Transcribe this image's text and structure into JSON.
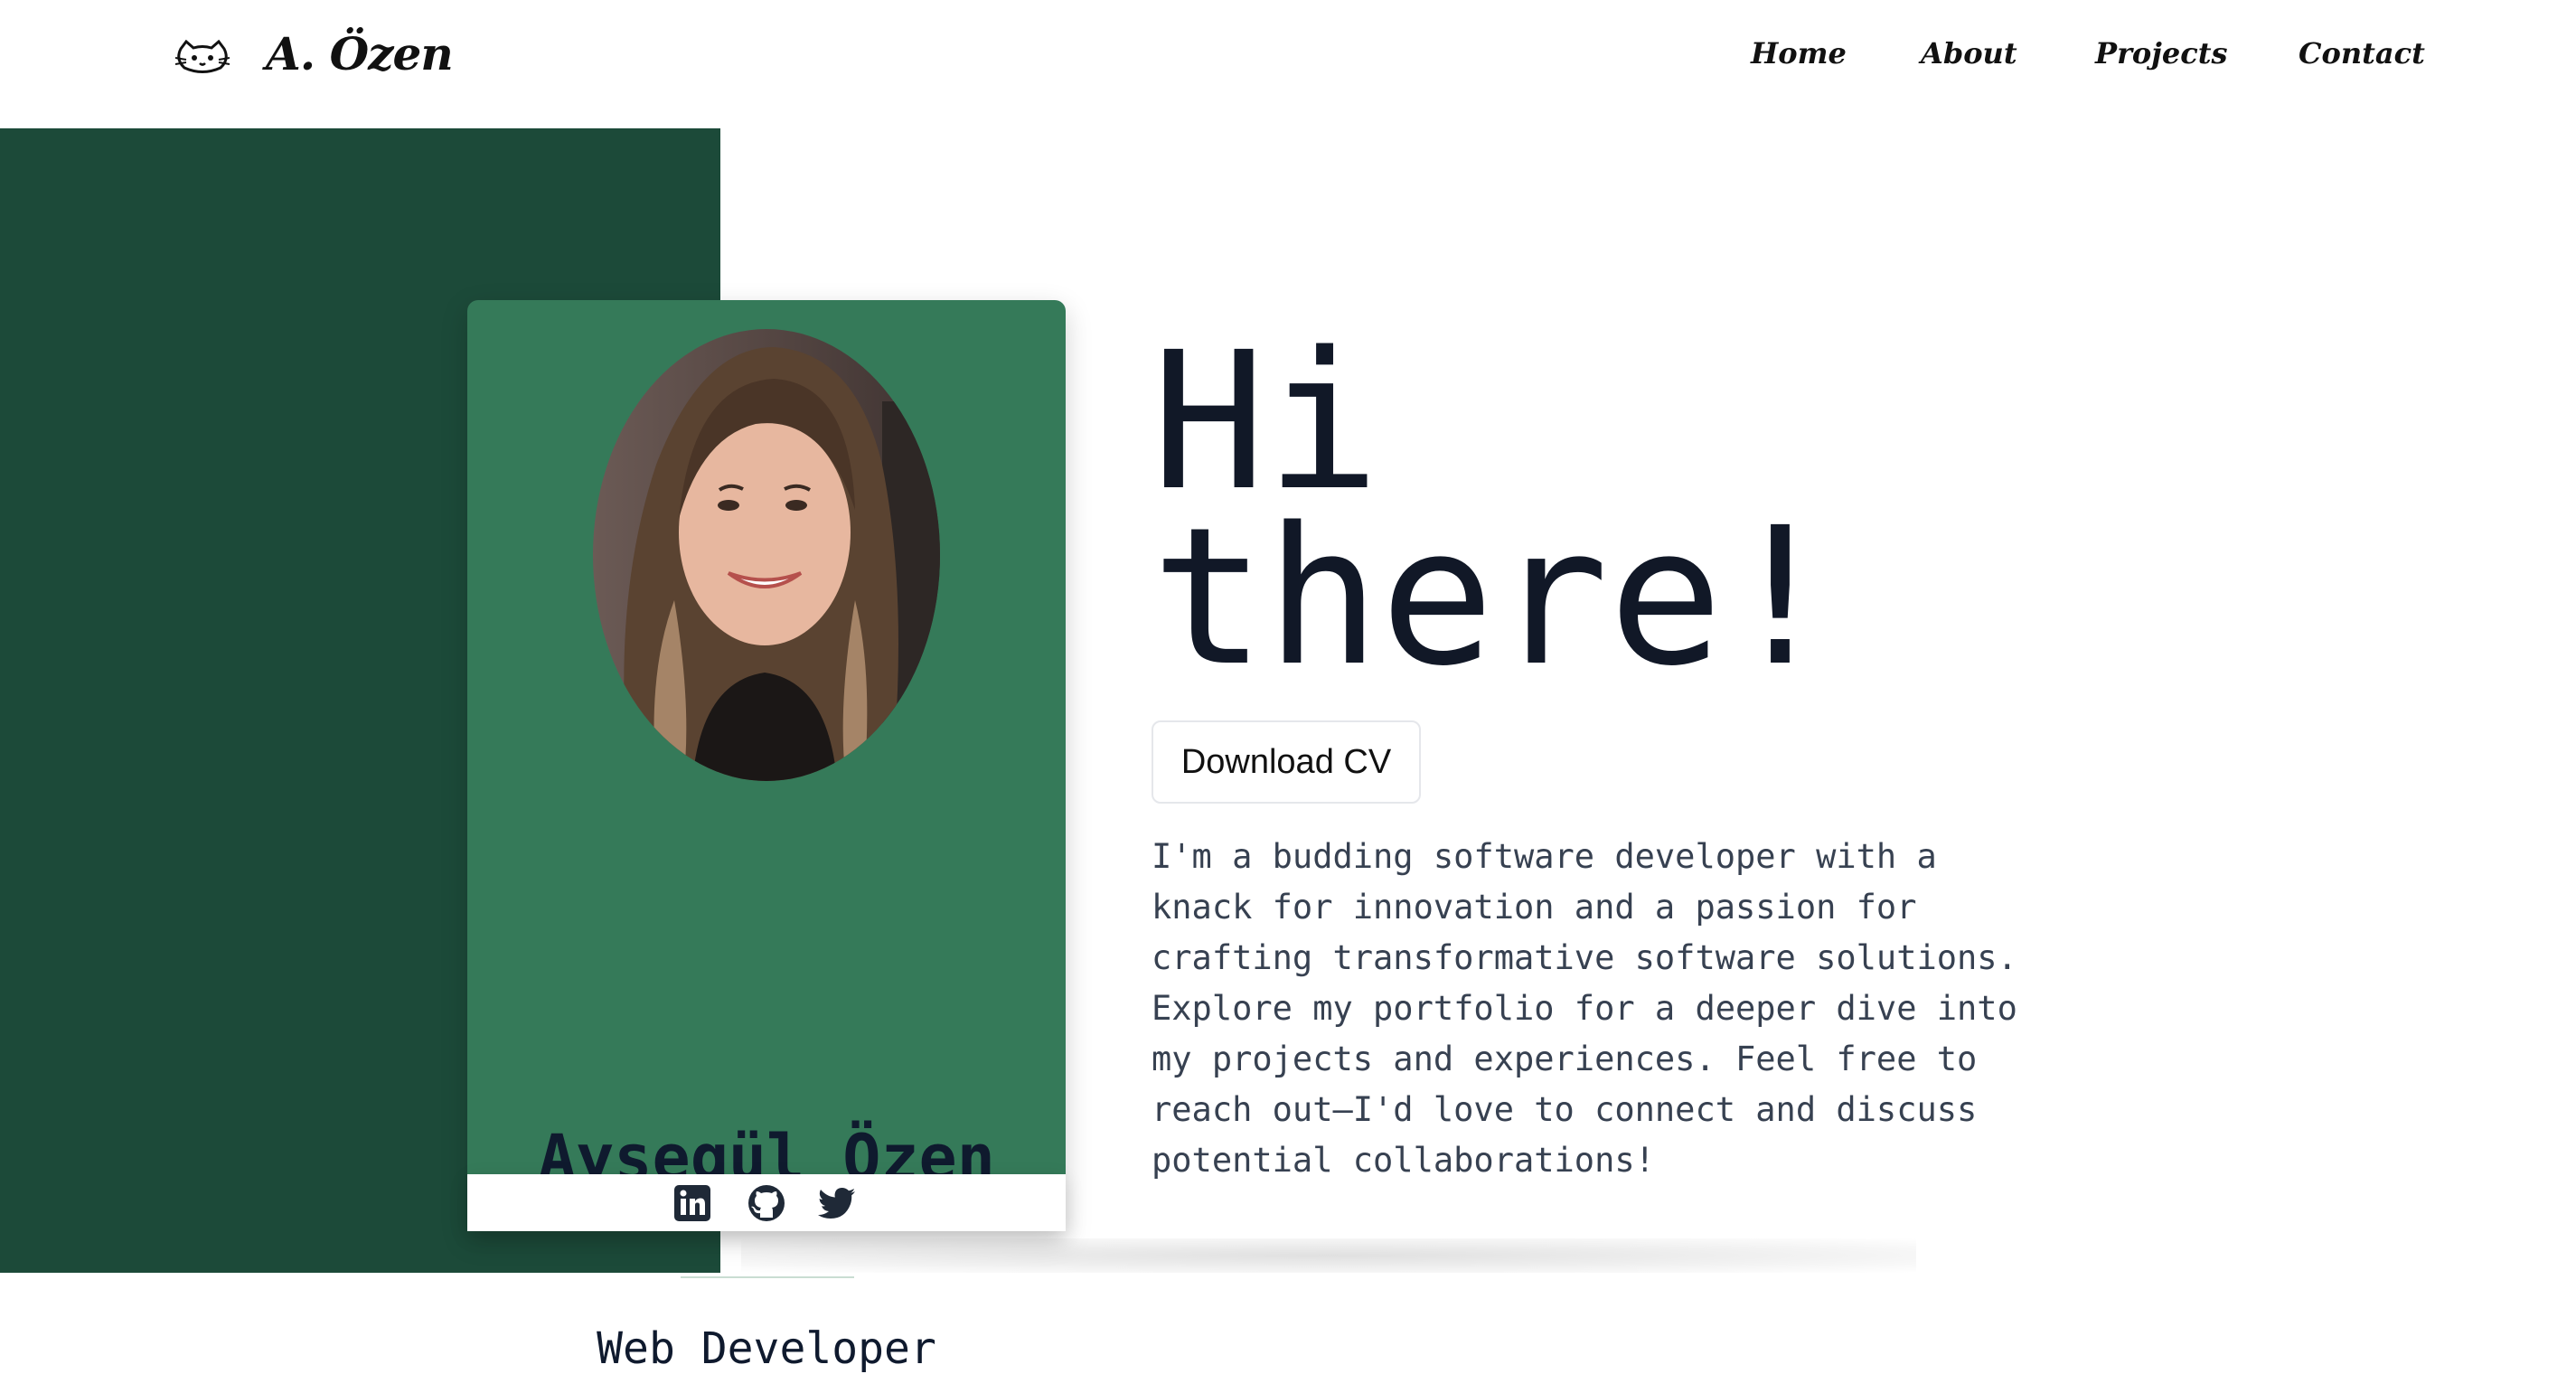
{
  "header": {
    "logo_icon": "cat-face-icon",
    "logo_text": "A. Özen",
    "nav": [
      "Home",
      "About",
      "Projects",
      "Contact"
    ]
  },
  "card": {
    "photo_alt": "profile-photo",
    "name": "Ayşegül Özen",
    "role": "Web Developer",
    "socials": [
      "linkedin-icon",
      "github-icon",
      "twitter-icon"
    ]
  },
  "hero": {
    "title_line1": "Hi",
    "title_line2": "there!",
    "cv_button": "Download CV",
    "intro": "I'm a budding software developer with a knack for innovation and a passion for crafting transformative software solutions. Explore my portfolio for a deeper dive into my projects and experiences. Feel free to reach out—I'd love to connect and discuss potential collaborations!"
  },
  "colors": {
    "dark_panel": "#1c4a39",
    "card": "#357a59",
    "text_dark": "#111827"
  }
}
